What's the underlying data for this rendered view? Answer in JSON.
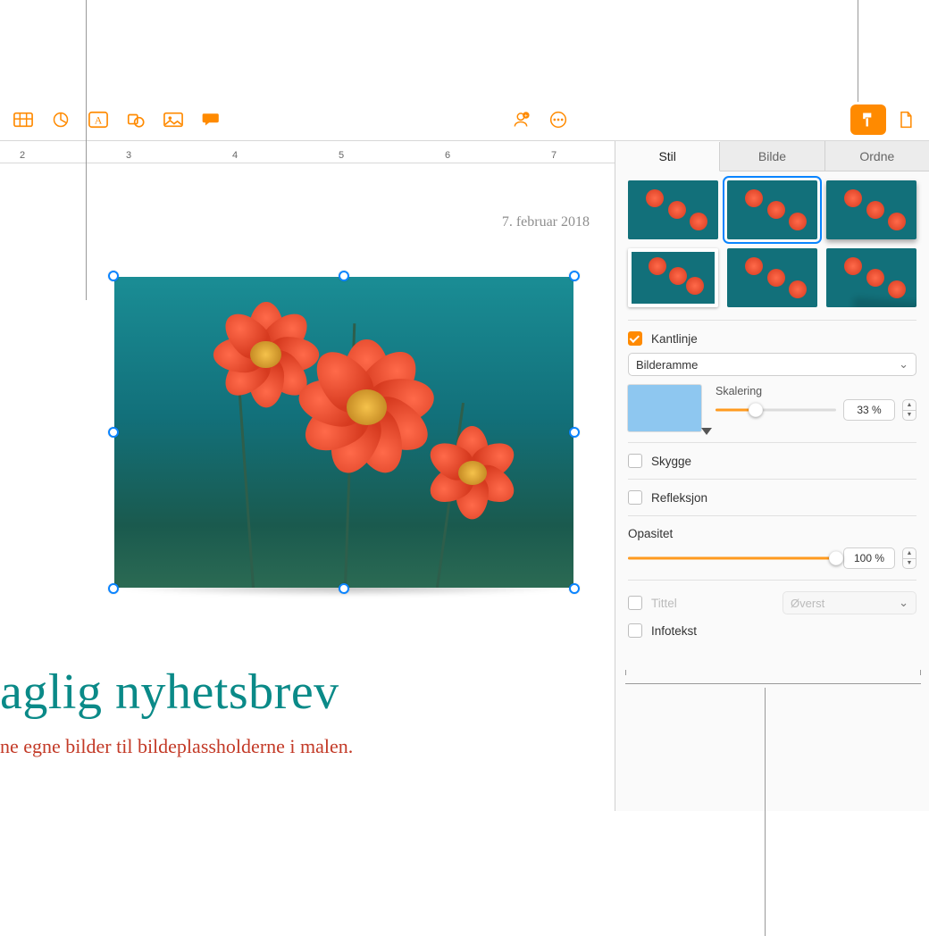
{
  "toolbar": {
    "icons": [
      "table-icon",
      "chart-icon",
      "text-icon",
      "shape-icon",
      "media-icon",
      "comment-icon",
      "collaborate-icon",
      "more-icon",
      "format-icon",
      "document-icon"
    ]
  },
  "ruler": {
    "units": [
      "2",
      "3",
      "4",
      "5",
      "6",
      "7"
    ]
  },
  "document": {
    "date": "7. februar 2018",
    "title_partial": "aglig nyhetsbrev",
    "subtitle_partial": "ne egne bilder til bildeplassholderne i malen."
  },
  "inspector": {
    "tabs": {
      "style": "Stil",
      "image": "Bilde",
      "arrange": "Ordne"
    },
    "border": {
      "checkbox_label": "Kantlinje",
      "checked": true,
      "dropdown": "Bilderamme",
      "scale_label": "Skalering",
      "scale_value": "33 %",
      "scale_fraction": 0.33
    },
    "shadow": {
      "label": "Skygge",
      "checked": false
    },
    "reflection": {
      "label": "Refleksjon",
      "checked": false
    },
    "opacity": {
      "label": "Opasitet",
      "value": "100 %",
      "fraction": 1.0
    },
    "title": {
      "label": "Tittel",
      "checked": false,
      "position_value": "Øverst"
    },
    "caption": {
      "label": "Infotekst",
      "checked": false
    }
  }
}
